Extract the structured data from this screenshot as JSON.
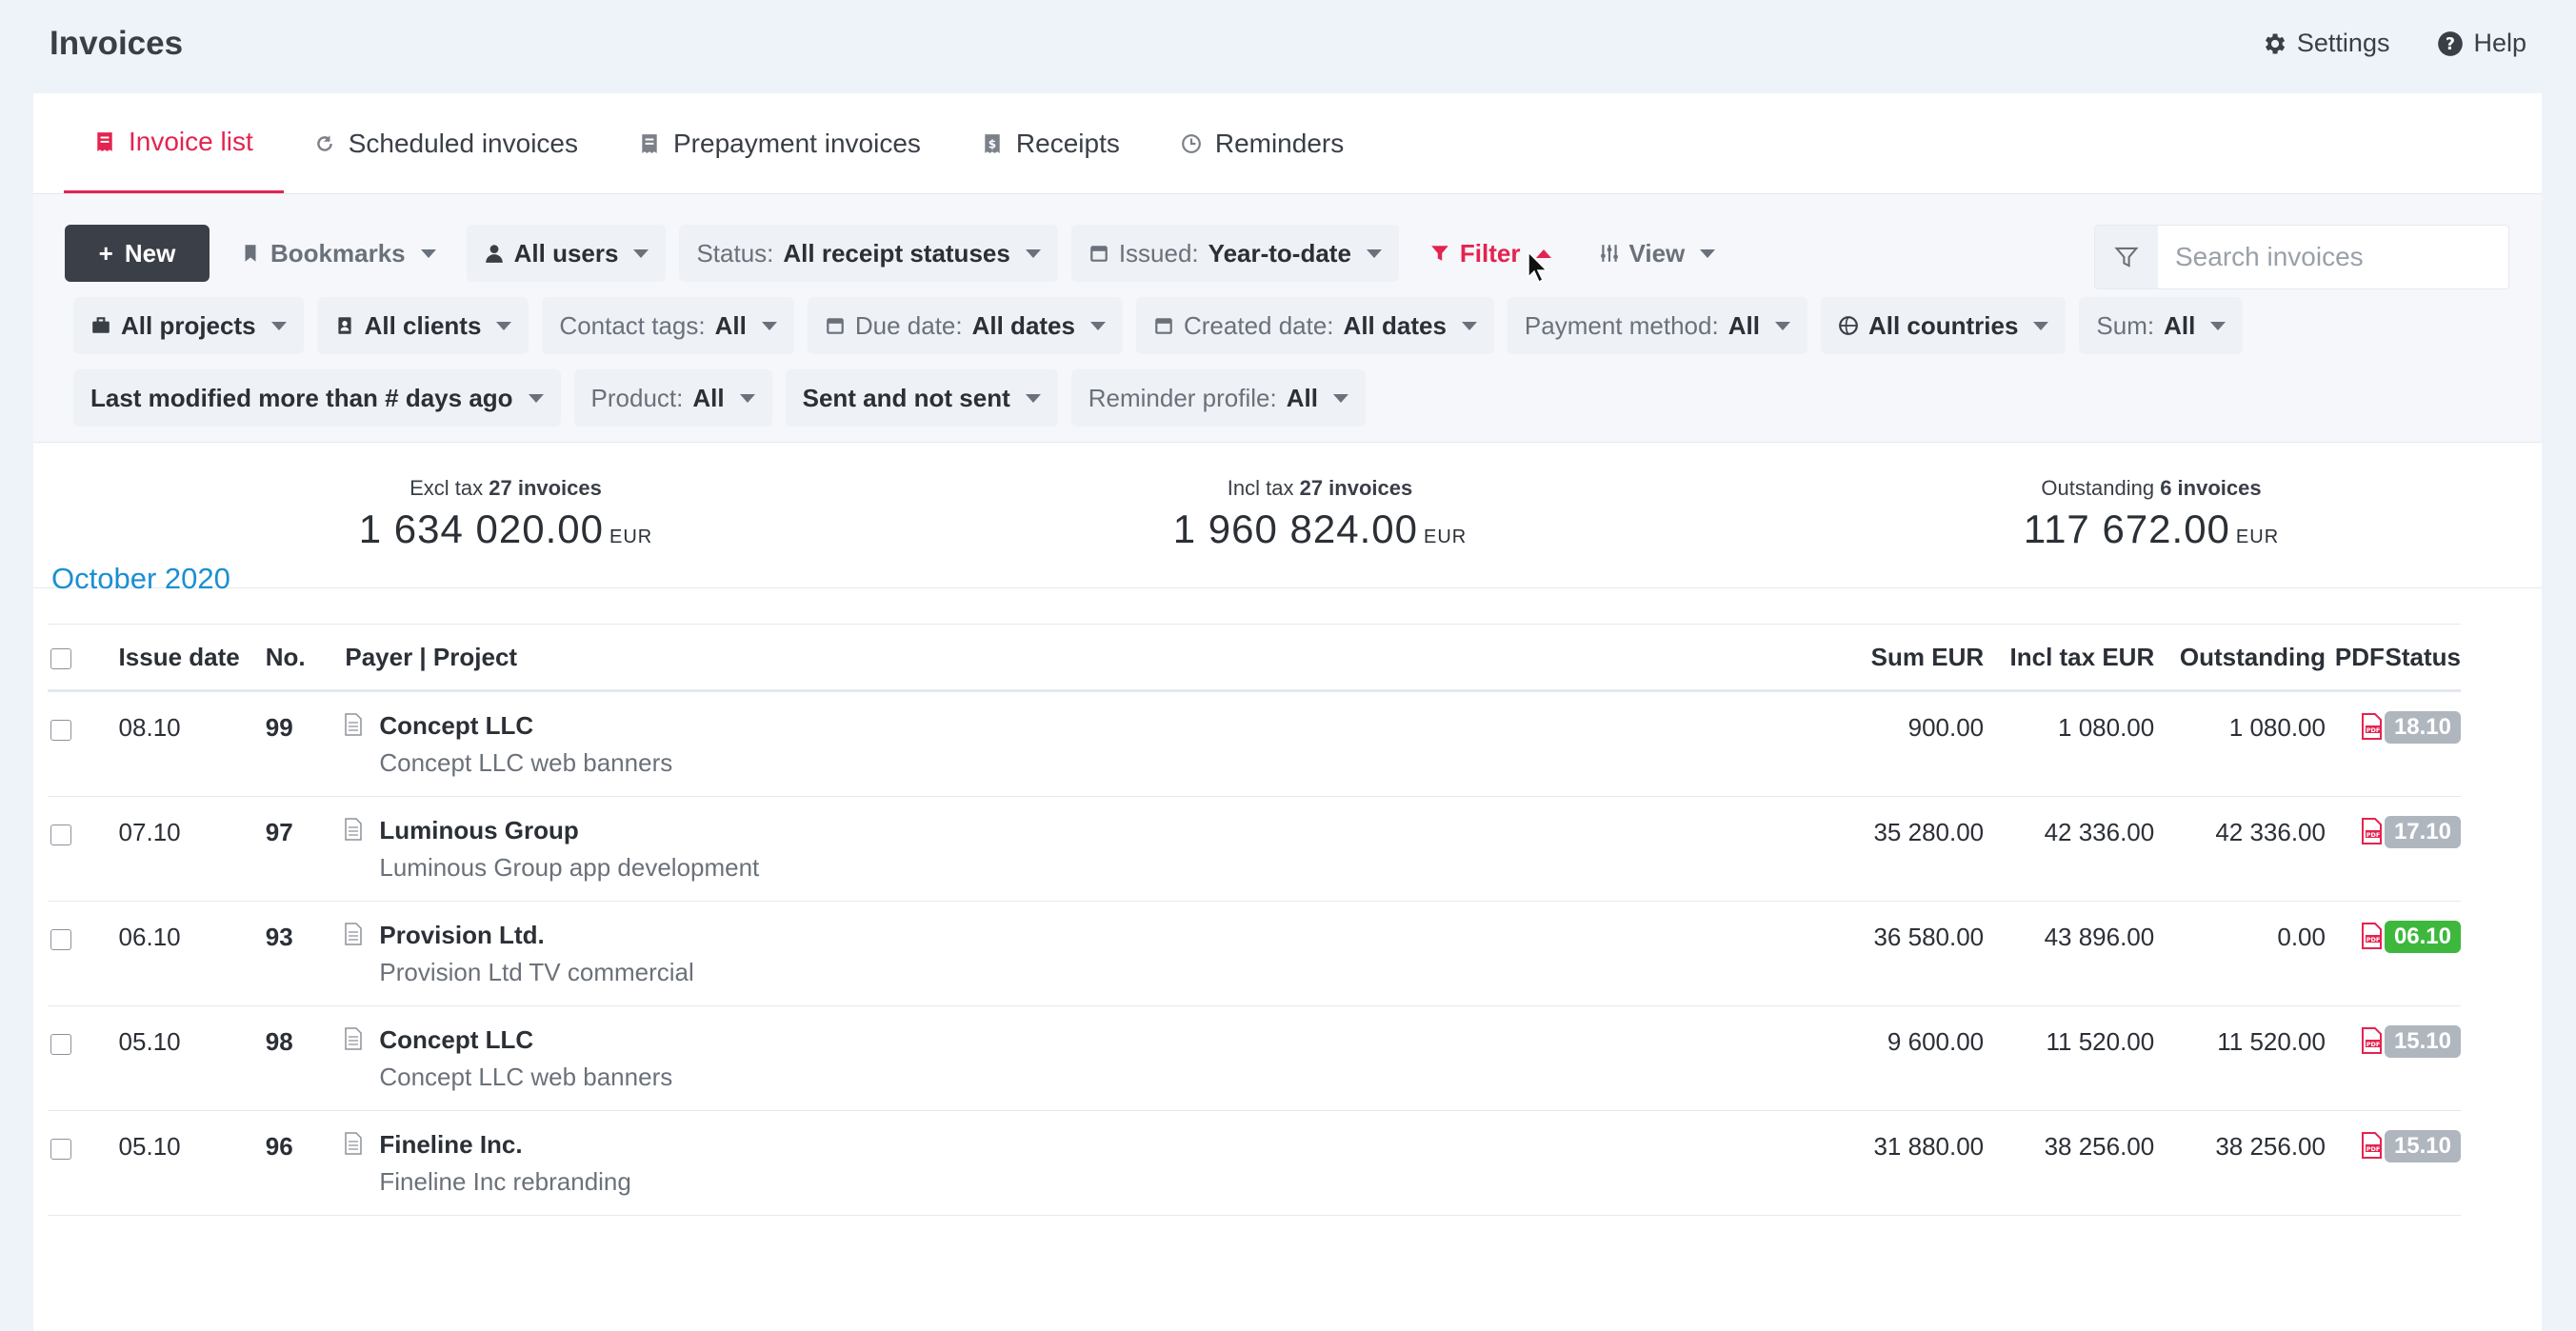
{
  "app": {
    "title": "Invoices"
  },
  "top_links": {
    "settings": "Settings",
    "help": "Help"
  },
  "tabs": [
    {
      "label": "Invoice list",
      "icon": "receipt-icon",
      "active": true
    },
    {
      "label": "Scheduled invoices",
      "icon": "refresh-icon",
      "active": false
    },
    {
      "label": "Prepayment invoices",
      "icon": "receipt-icon",
      "active": false
    },
    {
      "label": "Receipts",
      "icon": "dollar-receipt-icon",
      "active": false
    },
    {
      "label": "Reminders",
      "icon": "clock-icon",
      "active": false
    }
  ],
  "toolbar": {
    "new_label": "New",
    "bookmarks_label": "Bookmarks",
    "users_label": "All users",
    "status_key": "Status:",
    "status_value": "All receipt statuses",
    "issued_key": "Issued:",
    "issued_value": "Year-to-date",
    "filter_label": "Filter",
    "view_label": "View"
  },
  "search": {
    "placeholder": "Search invoices"
  },
  "filters_row2": [
    {
      "key": "",
      "value": "All projects"
    },
    {
      "key": "",
      "value": "All clients"
    },
    {
      "key": "Contact tags:",
      "value": "All"
    },
    {
      "key": "Due date:",
      "value": "All dates"
    },
    {
      "key": "Created date:",
      "value": "All dates"
    },
    {
      "key": "Payment method:",
      "value": "All"
    },
    {
      "key": "",
      "value": "All countries"
    },
    {
      "key": "Sum:",
      "value": "All"
    }
  ],
  "filters_row3": [
    {
      "key": "",
      "value": "Last modified more than # days ago"
    },
    {
      "key": "Product:",
      "value": "All"
    },
    {
      "key": "",
      "value": "Sent and not sent"
    },
    {
      "key": "Reminder profile:",
      "value": "All"
    }
  ],
  "totals": [
    {
      "caption": "Excl tax",
      "count": "27 invoices",
      "amount": "1 634 020.00",
      "currency": "EUR"
    },
    {
      "caption": "Incl tax",
      "count": "27 invoices",
      "amount": "1 960 824.00",
      "currency": "EUR"
    },
    {
      "caption": "Outstanding",
      "count": "6 invoices",
      "amount": "117 672.00",
      "currency": "EUR"
    }
  ],
  "month_heading": "October 2020",
  "table": {
    "headers": {
      "issue_date": "Issue date",
      "no": "No.",
      "payer": "Payer | Project",
      "sum": "Sum EUR",
      "incl": "Incl tax EUR",
      "outstanding": "Outstanding",
      "pdf": "PDF",
      "status": "Status"
    },
    "rows": [
      {
        "date": "08.10",
        "no": "99",
        "payer": "Concept LLC",
        "project": "Concept LLC web banners",
        "sum": "900.00",
        "incl": "1 080.00",
        "outstanding": "1 080.00",
        "status": "18.10",
        "status_color": "#b0b6be"
      },
      {
        "date": "07.10",
        "no": "97",
        "payer": "Luminous Group",
        "project": "Luminous Group app development",
        "sum": "35 280.00",
        "incl": "42 336.00",
        "outstanding": "42 336.00",
        "status": "17.10",
        "status_color": "#b0b6be"
      },
      {
        "date": "06.10",
        "no": "93",
        "payer": "Provision Ltd.",
        "project": "Provision Ltd TV commercial",
        "sum": "36 580.00",
        "incl": "43 896.00",
        "outstanding": "0.00",
        "status": "06.10",
        "status_color": "#3db83d"
      },
      {
        "date": "05.10",
        "no": "98",
        "payer": "Concept LLC",
        "project": "Concept LLC web banners",
        "sum": "9 600.00",
        "incl": "11 520.00",
        "outstanding": "11 520.00",
        "status": "15.10",
        "status_color": "#b0b6be"
      },
      {
        "date": "05.10",
        "no": "96",
        "payer": "Fineline Inc.",
        "project": "Fineline Inc rebranding",
        "sum": "31 880.00",
        "incl": "38 256.00",
        "outstanding": "38 256.00",
        "status": "15.10",
        "status_color": "#b0b6be"
      }
    ]
  }
}
